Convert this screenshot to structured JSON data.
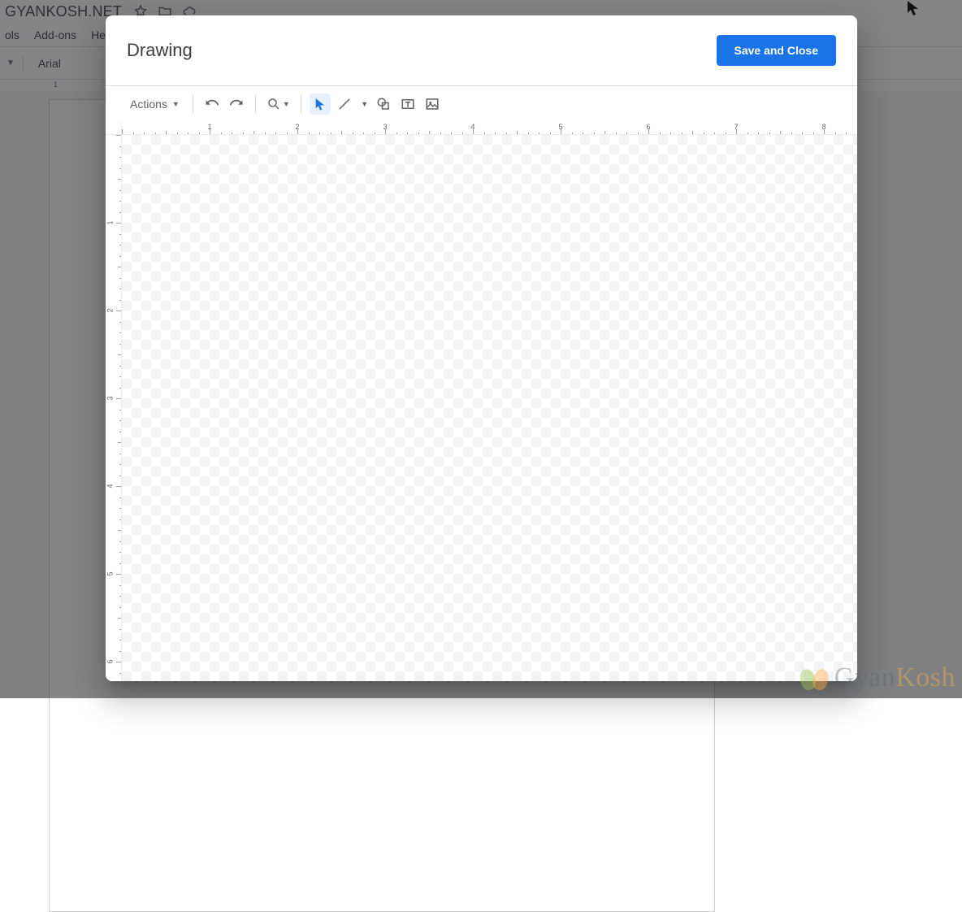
{
  "bg": {
    "doc_title": "GYANKOSH.NET",
    "menus": [
      "ols",
      "Add-ons",
      "He"
    ],
    "font_name": "Arial",
    "ruler_marks": [
      "1"
    ]
  },
  "dialog": {
    "title": "Drawing",
    "save_label": "Save and Close",
    "actions_label": "Actions",
    "h_ruler_numbers": [
      "1",
      "2",
      "3",
      "4",
      "5",
      "6",
      "7",
      "8"
    ],
    "v_ruler_numbers": [
      "1",
      "2",
      "3",
      "4",
      "5",
      "6"
    ]
  },
  "watermark": {
    "text_a": "Gyan",
    "text_b": "Kosh"
  }
}
